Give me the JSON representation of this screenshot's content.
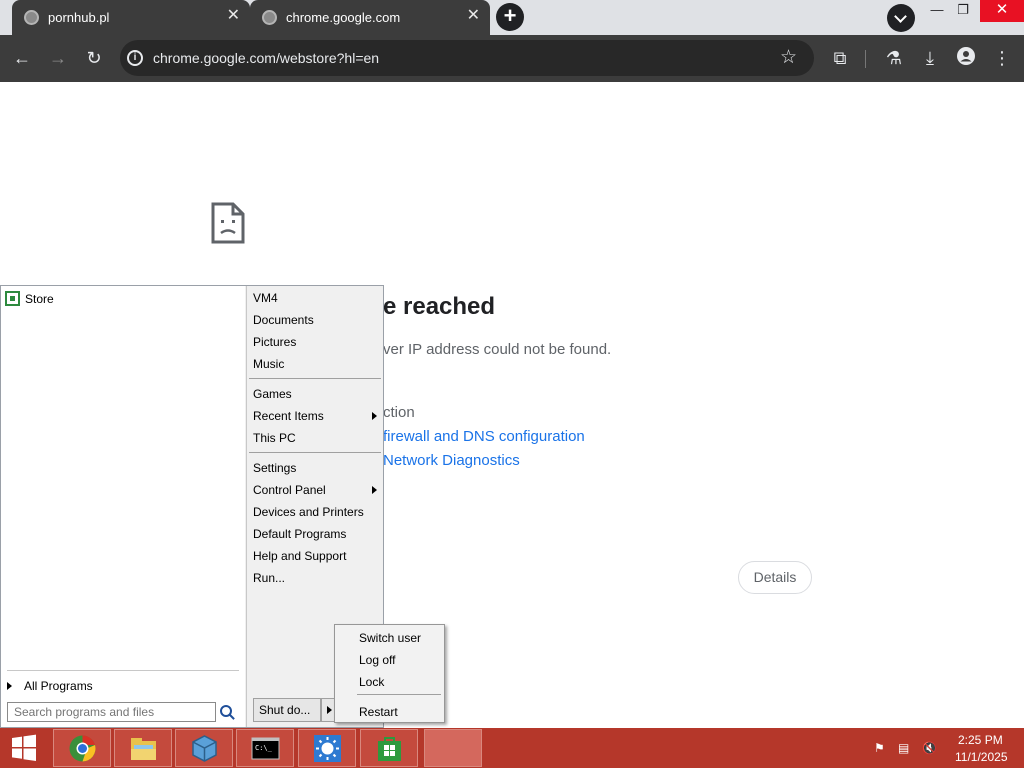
{
  "browser": {
    "tabs": [
      {
        "title": "pornhub.pl",
        "close": "✕"
      },
      {
        "title": "chrome.google.com",
        "close": "✕"
      }
    ],
    "new_tab": "+",
    "url": "chrome.google.com/webstore?hl=en",
    "window_controls": {
      "minimize": "—",
      "maximize": "❐",
      "close": "✕"
    }
  },
  "error_page": {
    "title": "e reached",
    "subtitle": "ver IP address could not be found.",
    "try_label": "ction",
    "link_firewall": "firewall and DNS configuration",
    "link_diagnostics": "Network Diagnostics",
    "details_button": "Details"
  },
  "start_menu": {
    "pinned": [
      {
        "label": "Store",
        "icon": "store-icon"
      }
    ],
    "all_programs": "All Programs",
    "search_placeholder": "Search programs and files",
    "right_items": [
      {
        "label": "VM4",
        "submenu": false
      },
      {
        "label": "Documents",
        "submenu": false
      },
      {
        "label": "Pictures",
        "submenu": false
      },
      {
        "label": "Music",
        "submenu": false
      },
      {
        "label": "Games",
        "submenu": false
      },
      {
        "label": "Recent Items",
        "submenu": true
      },
      {
        "label": "This PC",
        "submenu": false
      },
      {
        "label": "Settings",
        "submenu": false
      },
      {
        "label": "Control Panel",
        "submenu": true
      },
      {
        "label": "Devices and Printers",
        "submenu": false
      },
      {
        "label": "Default Programs",
        "submenu": false
      },
      {
        "label": "Help and Support",
        "submenu": false
      },
      {
        "label": "Run...",
        "submenu": false
      }
    ],
    "shutdown_label": "Shut do..."
  },
  "shutdown_menu": {
    "items": [
      "Switch user",
      "Log off",
      "Lock",
      "Restart"
    ]
  },
  "taskbar": {
    "apps": [
      "chrome-icon",
      "file-explorer-icon",
      "virtualbox-icon",
      "command-prompt-icon",
      "weather-icon",
      "store-icon"
    ],
    "clock_time": "2:25 PM",
    "clock_date": "11/1/2025",
    "accent": "#b5372a"
  }
}
